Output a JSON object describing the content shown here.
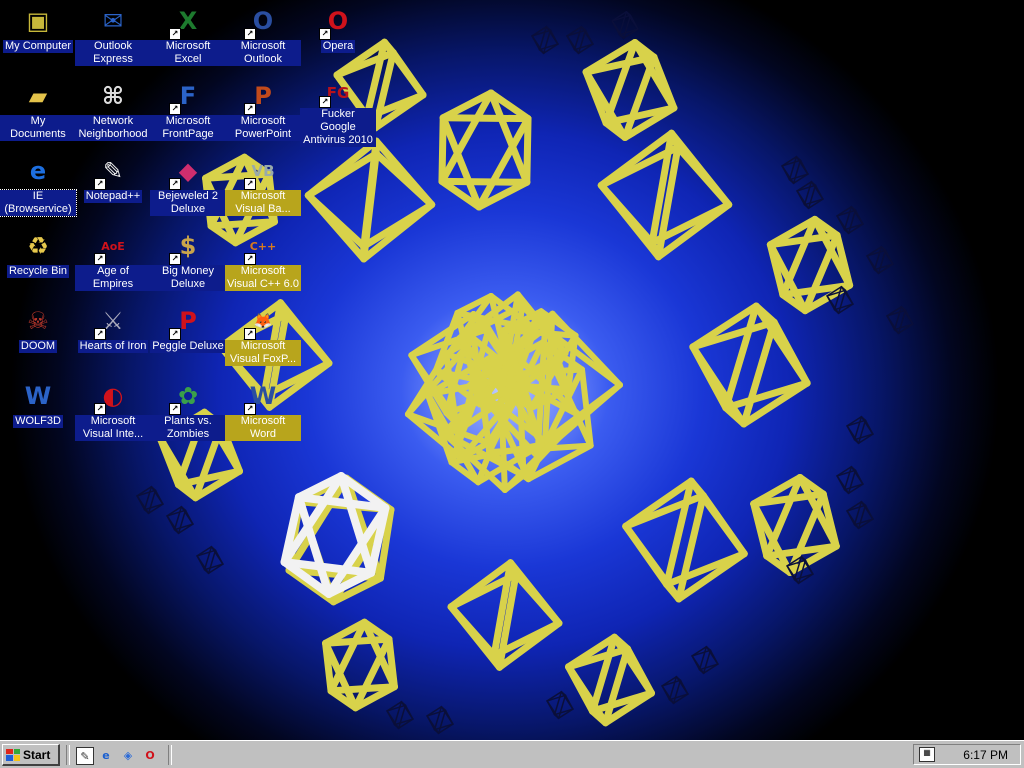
{
  "desktop": {
    "icons": [
      {
        "label": "My Computer",
        "icon": "my-computer-icon",
        "shortcut": false
      },
      {
        "label": "Outlook Express",
        "icon": "outlook-express-icon",
        "shortcut": false
      },
      {
        "label": "Microsoft Excel",
        "icon": "excel-icon",
        "shortcut": true
      },
      {
        "label": "Microsoft Outlook",
        "icon": "outlook-icon",
        "shortcut": true
      },
      {
        "label": "Opera",
        "icon": "opera-icon",
        "shortcut": true
      },
      {
        "label": "My Documents",
        "icon": "folder-icon",
        "shortcut": false
      },
      {
        "label": "Network Neighborhood",
        "icon": "network-icon",
        "shortcut": false
      },
      {
        "label": "Microsoft FrontPage",
        "icon": "frontpage-icon",
        "shortcut": true
      },
      {
        "label": "Microsoft PowerPoint",
        "icon": "powerpoint-icon",
        "shortcut": true
      },
      {
        "label": "Fucker Google Antivirus 2010",
        "icon": "antivirus-icon",
        "shortcut": true
      },
      {
        "label": "IE (Browservice)",
        "icon": "internet-explorer-icon",
        "shortcut": false
      },
      {
        "label": "Notepad++",
        "icon": "notepad-icon",
        "shortcut": true
      },
      {
        "label": "Bejeweled 2 Deluxe",
        "icon": "bejeweled-icon",
        "shortcut": true
      },
      {
        "label": "Microsoft Visual Ba...",
        "icon": "visual-basic-icon",
        "shortcut": true
      },
      {
        "label": "Recycle Bin",
        "icon": "recycle-bin-icon",
        "shortcut": false
      },
      {
        "label": "Age of Empires",
        "icon": "age-of-empires-icon",
        "shortcut": true
      },
      {
        "label": "Big Money Deluxe",
        "icon": "money-bag-icon",
        "shortcut": true
      },
      {
        "label": "Microsoft Visual C++ 6.0",
        "icon": "visual-cpp-icon",
        "shortcut": true
      },
      {
        "label": "DOOM",
        "icon": "doom-icon",
        "shortcut": false
      },
      {
        "label": "Hearts of Iron",
        "icon": "hearts-of-iron-icon",
        "shortcut": true
      },
      {
        "label": "Peggle Deluxe",
        "icon": "peggle-icon",
        "shortcut": true
      },
      {
        "label": "Microsoft Visual FoxP...",
        "icon": "visual-foxpro-icon",
        "shortcut": true
      },
      {
        "label": "WOLF3D",
        "icon": "wolf3d-icon",
        "shortcut": false
      },
      {
        "label": "Microsoft Visual Inte...",
        "icon": "visual-interdev-icon",
        "shortcut": true
      },
      {
        "label": "Plants vs. Zombies",
        "icon": "plants-vs-zombies-icon",
        "shortcut": true
      },
      {
        "label": "Microsoft Word",
        "icon": "word-icon",
        "shortcut": true
      }
    ]
  },
  "taskbar": {
    "start_label": "Start",
    "quick_launch": [
      "show-desktop-icon",
      "internet-explorer-icon",
      "channels-icon",
      "opera-icon"
    ],
    "clock": "6:17 PM"
  },
  "colors": {
    "accent_selected": "#b8a51c",
    "label_bg": "#0d1c8c",
    "taskbar": "#c0c0c0",
    "screensaver_frames": "#d8d24a"
  }
}
